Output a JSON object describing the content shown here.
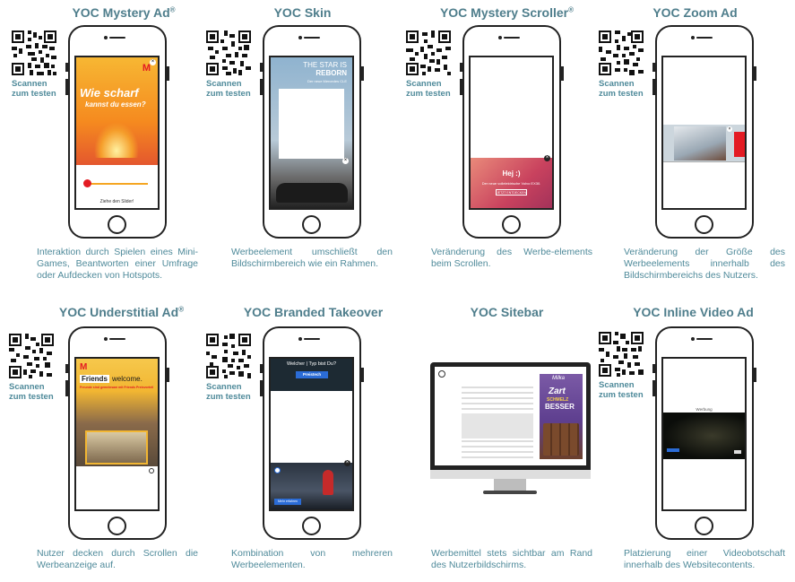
{
  "scan_line1": "Scannen",
  "scan_line2": "zum testen",
  "cards": [
    {
      "title": "YOC Mystery Ad",
      "reg": "®",
      "desc": "Interaktion durch Spielen eines Mini-Games, Beantworten einer Umfrage oder Aufdecken von Hotspots.",
      "ad": {
        "headline1": "Wie scharf",
        "headline2": "kannst du essen?",
        "hint": "Ziehe den Slider!"
      }
    },
    {
      "title": "YOC Skin",
      "reg": "",
      "desc": "Werbeelement umschließt den Bildschirmbereich wie ein Rahmen.",
      "ad": {
        "headline1": "THE STAR IS",
        "headline2": "REBORN",
        "hint": "Der neue Mercedes CLE"
      }
    },
    {
      "title": "YOC Mystery Scroller",
      "reg": "®",
      "desc": "Veränderung des Werbe-elements beim Scrollen.",
      "ad": {
        "headline1": "Hej :)",
        "headline2": "Der neue vollelektrische Volvo EX30.",
        "hint": "JETZT ENTDECKEN"
      }
    },
    {
      "title": "YOC Zoom Ad",
      "reg": "",
      "desc": "Veränderung der Größe des Werbeelements innerhalb des Bildschirmbereichs des Nutzers."
    },
    {
      "title": "YOC Understitial Ad",
      "reg": "®",
      "desc": "Nutzer decken durch Scrollen die Werbeanzeige auf.",
      "ad": {
        "headline1": "Friends",
        "headline2": "welcome.",
        "hint": "Freunde sind gemeinsam mit Friends Preisvorteil"
      }
    },
    {
      "title": "YOC Branded Takeover",
      "reg": "",
      "desc": "Kombination von mehreren Werbeelementen.",
      "ad": {
        "headline1": "Welcher | Typ bist Du?",
        "headline2": "Preistech",
        "hint": "Mehr erfahren"
      }
    },
    {
      "title": "YOC Sitebar",
      "reg": "",
      "desc": "Werbemittel stets sichtbar am Rand des Nutzerbildschirms.",
      "ad": {
        "headline1": "Zart",
        "headline2": "SCHMELZ",
        "hint": "BESSER"
      }
    },
    {
      "title": "YOC Inline Video Ad",
      "reg": "",
      "desc": "Platzierung einer Videobotschaft innerhalb des Websitecontents.",
      "ad": {
        "headline1": "Werbung"
      }
    }
  ]
}
